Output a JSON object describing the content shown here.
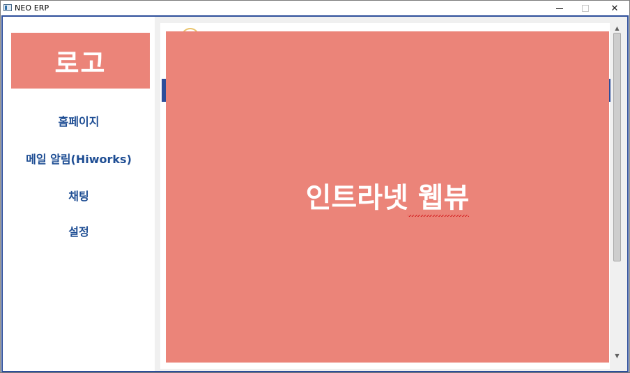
{
  "window": {
    "title": "NEO ERP",
    "controls": {
      "minimize": "—",
      "maximize": "□",
      "close": "✕"
    }
  },
  "sidebar": {
    "logo": "로고",
    "items": [
      {
        "label": "홈페이지"
      },
      {
        "label": "메일 알림(Hiworks)"
      },
      {
        "label": "채팅"
      },
      {
        "label": "설정"
      }
    ]
  },
  "main": {
    "webview_label": "인트라넷 웹뷰"
  },
  "scrollbar": {
    "up": "▲",
    "down": "▼"
  },
  "colors": {
    "accent": "#eb8479",
    "nav_text": "#1f4e94",
    "border": "#2d4e9a"
  },
  "icons": [
    "app-icon",
    "minimize-icon",
    "maximize-icon",
    "close-icon"
  ]
}
